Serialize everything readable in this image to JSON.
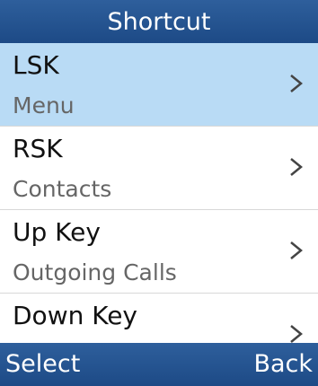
{
  "header": {
    "title": "Shortcut"
  },
  "items": [
    {
      "label": "LSK",
      "value": "Menu",
      "selected": true
    },
    {
      "label": "RSK",
      "value": "Contacts",
      "selected": false
    },
    {
      "label": "Up Key",
      "value": "Outgoing Calls",
      "selected": false
    },
    {
      "label": "Down Key",
      "value": "",
      "selected": false
    }
  ],
  "softkeys": {
    "left": "Select",
    "right": "Back"
  },
  "icons": {
    "chevron": "chevron-right-icon"
  },
  "colors": {
    "bar": "#1d4a86",
    "highlight": "#b9dbf5"
  }
}
